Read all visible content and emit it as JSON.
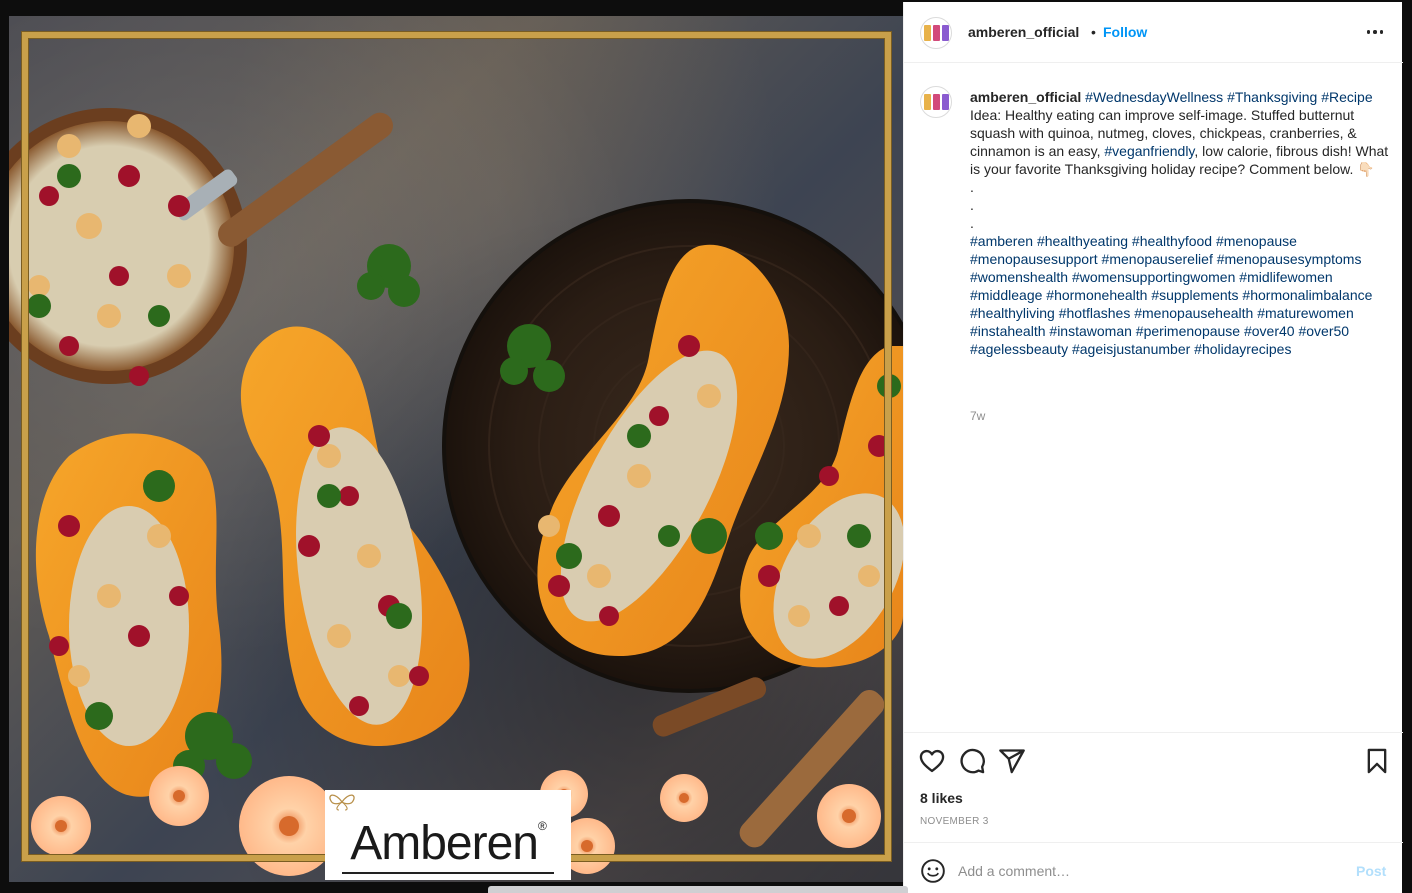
{
  "post": {
    "username": "amberen_official",
    "follow_label": "Follow",
    "dot": "•",
    "caption": {
      "username": "amberen_official",
      "lead_tags": [
        "#WednesdayWellness",
        "#Thanksgiving",
        "#Recipe"
      ],
      "text_1": "Idea: Healthy eating can improve self-image. Stuffed butternut squash with quinoa, nutmeg, cloves, chickpeas, cranberries, & cinnamon is an easy,",
      "mid_tag": "#veganfriendly",
      "text_2": ", low calorie, fibrous dish! What is your favorite Thanksgiving holiday recipe? Comment below. 👇🏻",
      "dots": [
        ".",
        ".",
        "."
      ],
      "hashtags": [
        "#amberen",
        "#healthyeating",
        "#healthyfood",
        "#menopause",
        "#menopausesupport",
        "#menopauserelief",
        "#menopausesymptoms",
        "#womenshealth",
        "#womensupportingwomen",
        "#midlifewomen",
        "#middleage",
        "#hormonehealth",
        "#supplements",
        "#hormonalimbalance",
        "#healthyliving",
        "#hotflashes",
        "#menopausehealth",
        "#maturewomen",
        "#instahealth",
        "#instawoman",
        "#perimenopause",
        "#over40",
        "#over50",
        "#agelessbeauty",
        "#ageisjustanumber",
        "#holidayrecipes"
      ]
    },
    "time_ago": "7w",
    "likes": "8 likes",
    "date": "NOVEMBER 3",
    "comment_placeholder": "Add a comment…",
    "post_label": "Post"
  },
  "image": {
    "brand_text": "Amberen",
    "brand_trademark": "®"
  },
  "colors": {
    "link_blue": "#0095f6",
    "hashtag": "#00376b",
    "gold": "#c9a04a",
    "squash": "#f39a1e"
  },
  "icons": [
    "heart-icon",
    "comment-icon",
    "share-icon",
    "save-icon",
    "emoji-icon",
    "more-icon"
  ]
}
